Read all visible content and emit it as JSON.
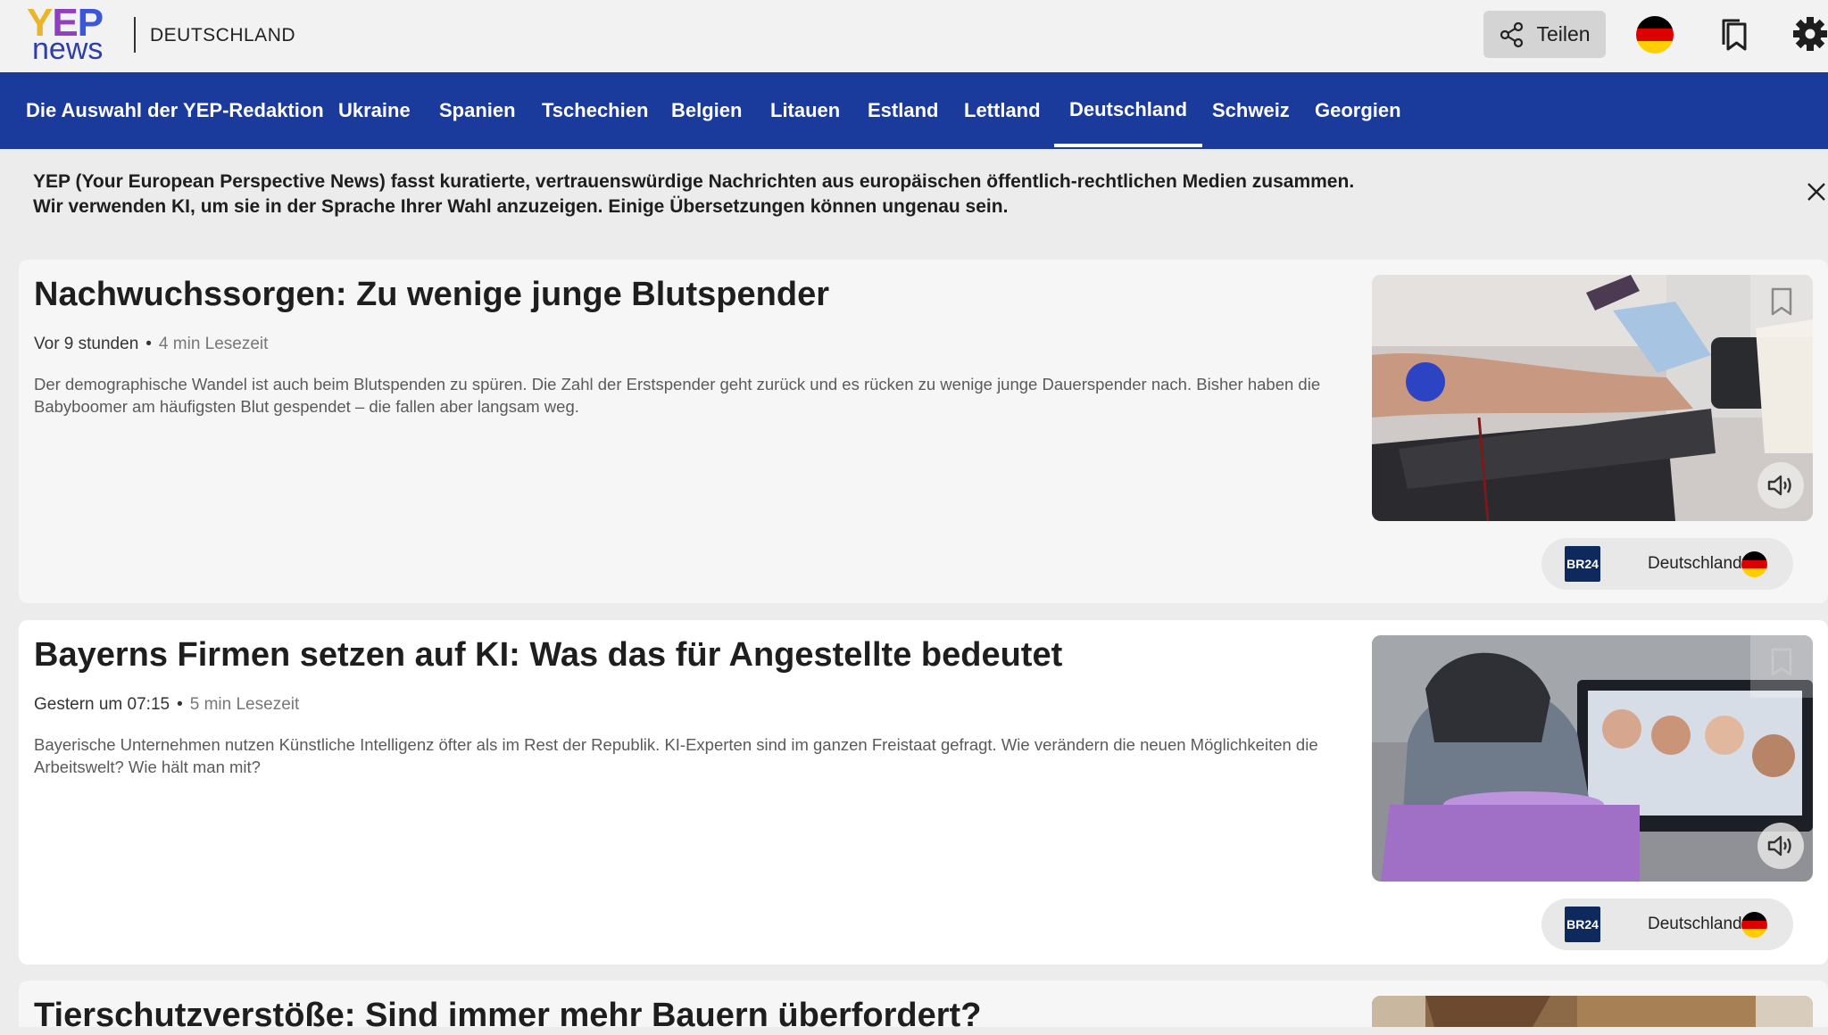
{
  "header": {
    "logo_text_top": "YEP",
    "logo_text_bottom": "news",
    "country_label": "DEUTSCHLAND",
    "share_label": "Teilen"
  },
  "nav": {
    "items": [
      {
        "label": "Die Auswahl der YEP-Redaktion",
        "active": false
      },
      {
        "label": "Ukraine",
        "active": false
      },
      {
        "label": "Spanien",
        "active": false
      },
      {
        "label": "Tschechien",
        "active": false
      },
      {
        "label": "Belgien",
        "active": false
      },
      {
        "label": "Litauen",
        "active": false
      },
      {
        "label": "Estland",
        "active": false
      },
      {
        "label": "Lettland",
        "active": false
      },
      {
        "label": "Deutschland",
        "active": true
      },
      {
        "label": "Schweiz",
        "active": false
      },
      {
        "label": "Georgien",
        "active": false
      }
    ]
  },
  "banner": {
    "line1": "YEP (Your European Perspective News) fasst kuratierte, vertrauenswürdige Nachrichten aus europäischen öffentlich-rechtlichen Medien zusammen.",
    "line2": "Wir verwenden KI, um sie in der Sprache Ihrer Wahl anzuzeigen. Einige Übersetzungen können ungenau sein."
  },
  "articles": [
    {
      "title": "Nachwuchssorgen: Zu wenige junge Blutspender",
      "time": "Vor 9 stunden",
      "read_time": "4 min Lesezeit",
      "summary": "Der demographische Wandel ist auch beim Blutspenden zu spüren. Die Zahl der Erstspender geht zurück und es rücken zu wenige junge Dauerspender nach. Bisher haben die Babyboomer am häufigsten Blut gespendet – die fallen aber langsam weg.",
      "source_logo": "BR24",
      "source_country": "Deutschland"
    },
    {
      "title": "Bayerns Firmen setzen auf KI: Was das für Angestellte bedeutet",
      "time": "Gestern um 07:15",
      "read_time": "5 min Lesezeit",
      "summary": "Bayerische Unternehmen nutzen Künstliche Intelligenz öfter als im Rest der Republik. KI-Experten sind im ganzen Freistaat gefragt. Wie verändern die neuen Möglichkeiten die Arbeitswelt? Wie hält man mit?",
      "source_logo": "BR24",
      "source_country": "Deutschland"
    },
    {
      "title": "Tierschutzverstöße: Sind immer mehr Bauern überfordert?"
    }
  ],
  "colors": {
    "nav_bg": "#1a3a9c",
    "flag_black": "#000000",
    "flag_red": "#dd0000",
    "flag_gold": "#ffce00"
  }
}
